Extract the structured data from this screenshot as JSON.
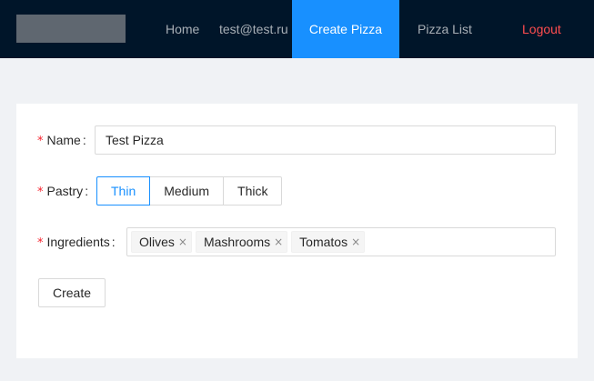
{
  "nav": {
    "home": "Home",
    "email": "test@test.ru",
    "create_pizza": "Create Pizza",
    "pizza_list": "Pizza List",
    "logout": "Logout"
  },
  "form": {
    "required_mark": "*",
    "name": {
      "label": "Name",
      "value": "Test Pizza"
    },
    "pastry": {
      "label": "Pastry",
      "options": [
        "Thin",
        "Medium",
        "Thick"
      ],
      "selected": "Thin"
    },
    "ingredients": {
      "label": "Ingredients",
      "tags": [
        "Olives",
        "Mashrooms",
        "Tomatos"
      ],
      "remove_glyph": "×"
    },
    "submit_label": "Create"
  },
  "colors": {
    "header_bg": "#001529",
    "accent": "#1890ff",
    "logout": "#ff4d4f",
    "required": "#f5222d"
  }
}
